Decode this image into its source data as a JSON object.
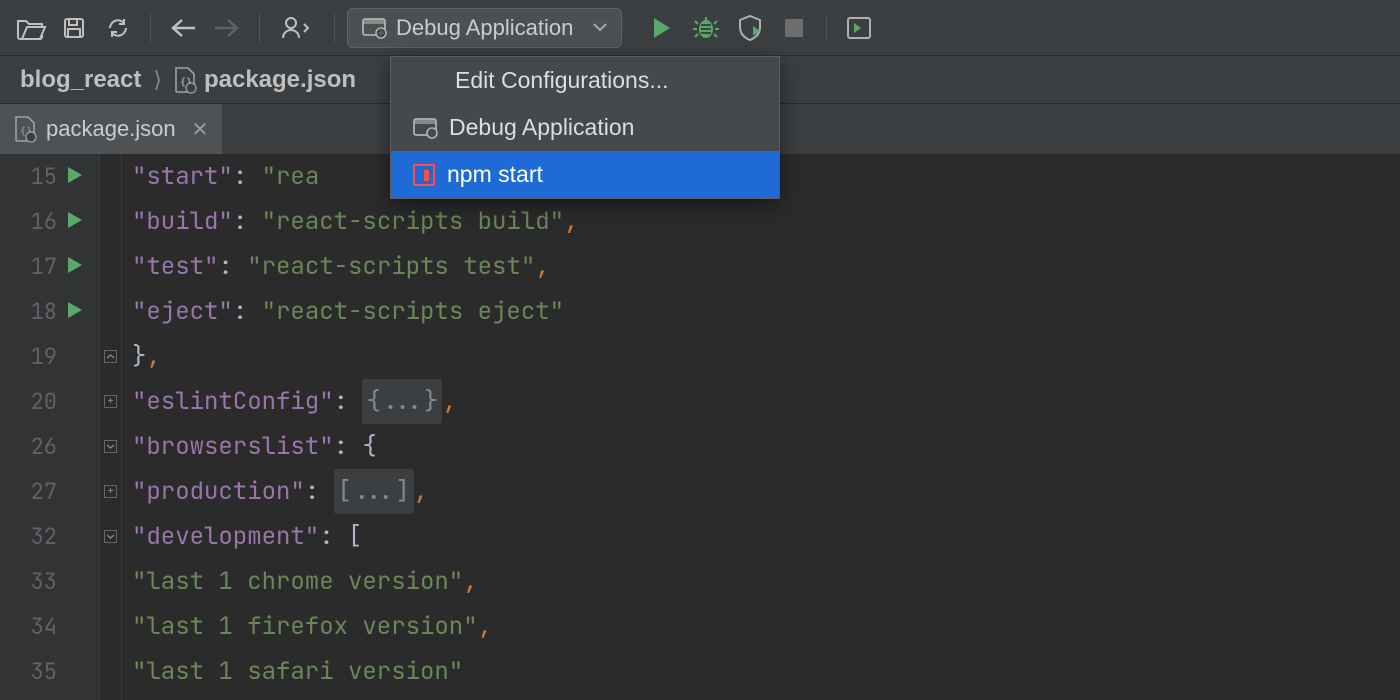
{
  "toolbar": {
    "config_label": "Debug Application"
  },
  "breadcrumbs": {
    "root": "blog_react",
    "file": "package.json"
  },
  "tab": {
    "title": "package.json"
  },
  "popup": {
    "edit": "Edit Configurations...",
    "debug": "Debug Application",
    "npm": "npm start"
  },
  "code": {
    "lines": [
      {
        "n": "15",
        "run": true,
        "fold": "",
        "indent": 4,
        "tokens": [
          {
            "t": "key",
            "v": "\"start\""
          },
          {
            "t": "brace",
            "v": ": "
          },
          {
            "t": "str",
            "v": "\"rea"
          }
        ]
      },
      {
        "n": "16",
        "run": true,
        "fold": "",
        "indent": 4,
        "tokens": [
          {
            "t": "key",
            "v": "\"build\""
          },
          {
            "t": "brace",
            "v": ": "
          },
          {
            "t": "str",
            "v": "\"react-scripts build\""
          },
          {
            "t": "punct",
            "v": ","
          }
        ]
      },
      {
        "n": "17",
        "run": true,
        "fold": "",
        "indent": 4,
        "tokens": [
          {
            "t": "key",
            "v": "\"test\""
          },
          {
            "t": "brace",
            "v": ": "
          },
          {
            "t": "str",
            "v": "\"react-scripts test\""
          },
          {
            "t": "punct",
            "v": ","
          }
        ]
      },
      {
        "n": "18",
        "run": true,
        "fold": "",
        "indent": 4,
        "tokens": [
          {
            "t": "key",
            "v": "\"eject\""
          },
          {
            "t": "brace",
            "v": ": "
          },
          {
            "t": "str",
            "v": "\"react-scripts eject\""
          }
        ]
      },
      {
        "n": "19",
        "run": false,
        "fold": "up",
        "indent": 2,
        "tokens": [
          {
            "t": "brace",
            "v": "}"
          },
          {
            "t": "punct",
            "v": ","
          }
        ]
      },
      {
        "n": "20",
        "run": false,
        "fold": "plus",
        "indent": 2,
        "tokens": [
          {
            "t": "key",
            "v": "\"eslintConfig\""
          },
          {
            "t": "brace",
            "v": ": "
          },
          {
            "t": "folded",
            "v": "{...}"
          },
          {
            "t": "punct",
            "v": ","
          }
        ]
      },
      {
        "n": "26",
        "run": false,
        "fold": "down",
        "indent": 2,
        "tokens": [
          {
            "t": "key",
            "v": "\"browserslist\""
          },
          {
            "t": "brace",
            "v": ": {"
          }
        ]
      },
      {
        "n": "27",
        "run": false,
        "fold": "plus",
        "indent": 4,
        "tokens": [
          {
            "t": "key",
            "v": "\"production\""
          },
          {
            "t": "brace",
            "v": ": "
          },
          {
            "t": "folded",
            "v": "[...]"
          },
          {
            "t": "punct",
            "v": ","
          }
        ]
      },
      {
        "n": "32",
        "run": false,
        "fold": "down",
        "indent": 4,
        "tokens": [
          {
            "t": "key",
            "v": "\"development\""
          },
          {
            "t": "brace",
            "v": ": ["
          }
        ]
      },
      {
        "n": "33",
        "run": false,
        "fold": "",
        "indent": 6,
        "tokens": [
          {
            "t": "str",
            "v": "\"last 1 chrome version\""
          },
          {
            "t": "punct",
            "v": ","
          }
        ]
      },
      {
        "n": "34",
        "run": false,
        "fold": "",
        "indent": 6,
        "tokens": [
          {
            "t": "str",
            "v": "\"last 1 firefox version\""
          },
          {
            "t": "punct",
            "v": ","
          }
        ]
      },
      {
        "n": "35",
        "run": false,
        "fold": "",
        "indent": 6,
        "tokens": [
          {
            "t": "str",
            "v": "\"last 1 safari version\""
          }
        ]
      }
    ]
  }
}
